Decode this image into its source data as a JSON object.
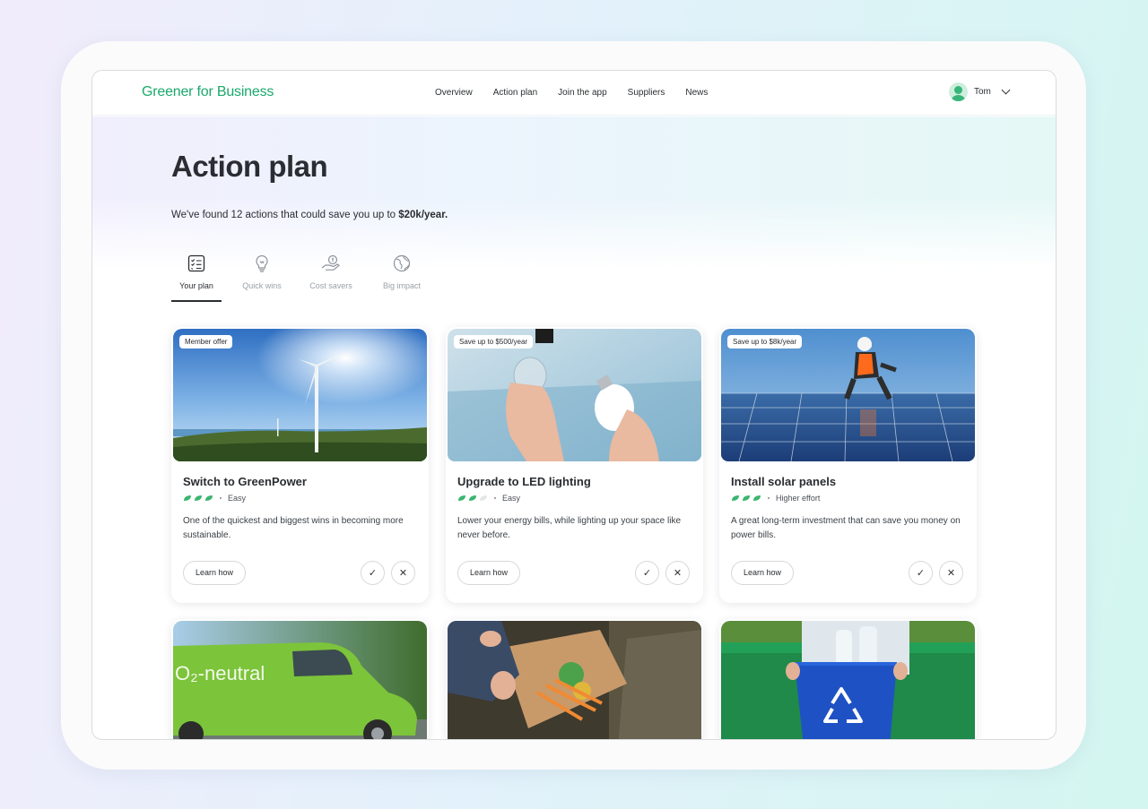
{
  "app": {
    "logo": "Greener for Business"
  },
  "nav": {
    "items": [
      "Overview",
      "Action plan",
      "Join the app",
      "Suppliers",
      "News"
    ]
  },
  "user": {
    "name": "Tom"
  },
  "page": {
    "title": "Action plan",
    "subtitle_prefix": "We've found 12 actions that could save you up to ",
    "subtitle_amount": "$20k/year."
  },
  "tabs": [
    {
      "label": "Your plan",
      "icon": "checklist-icon",
      "active": true
    },
    {
      "label": "Quick wins",
      "icon": "lightbulb-icon",
      "active": false
    },
    {
      "label": "Cost savers",
      "icon": "hand-coin-icon",
      "active": false
    },
    {
      "label": "Big impact",
      "icon": "globe-icon",
      "active": false
    }
  ],
  "cards": [
    {
      "badge": "Member offer",
      "title": "Switch to GreenPower",
      "rating": 3,
      "effort": "Easy",
      "desc": "One of the quickest and biggest wins in becoming more sustainable.",
      "cta": "Learn how",
      "image": "wind-turbine"
    },
    {
      "badge": "Save up to $500/year",
      "title": "Upgrade to LED lighting",
      "rating": 2,
      "effort": "Easy",
      "desc": "Lower your energy bills, while lighting up your space like never before.",
      "cta": "Learn how",
      "image": "led-bulbs"
    },
    {
      "badge": "Save up to $8k/year",
      "title": "Install solar panels",
      "rating": 3,
      "effort": "Higher effort",
      "desc": "A great long-term investment that can save you money on power bills.",
      "cta": "Learn how",
      "image": "solar-panels"
    }
  ],
  "more_cards": [
    {
      "image": "green-van",
      "image_text": "O₂-neutral"
    },
    {
      "image": "food-compost"
    },
    {
      "image": "recycling-bin"
    }
  ],
  "colors": {
    "brand": "#1aa96b",
    "text": "#2a2d31"
  }
}
